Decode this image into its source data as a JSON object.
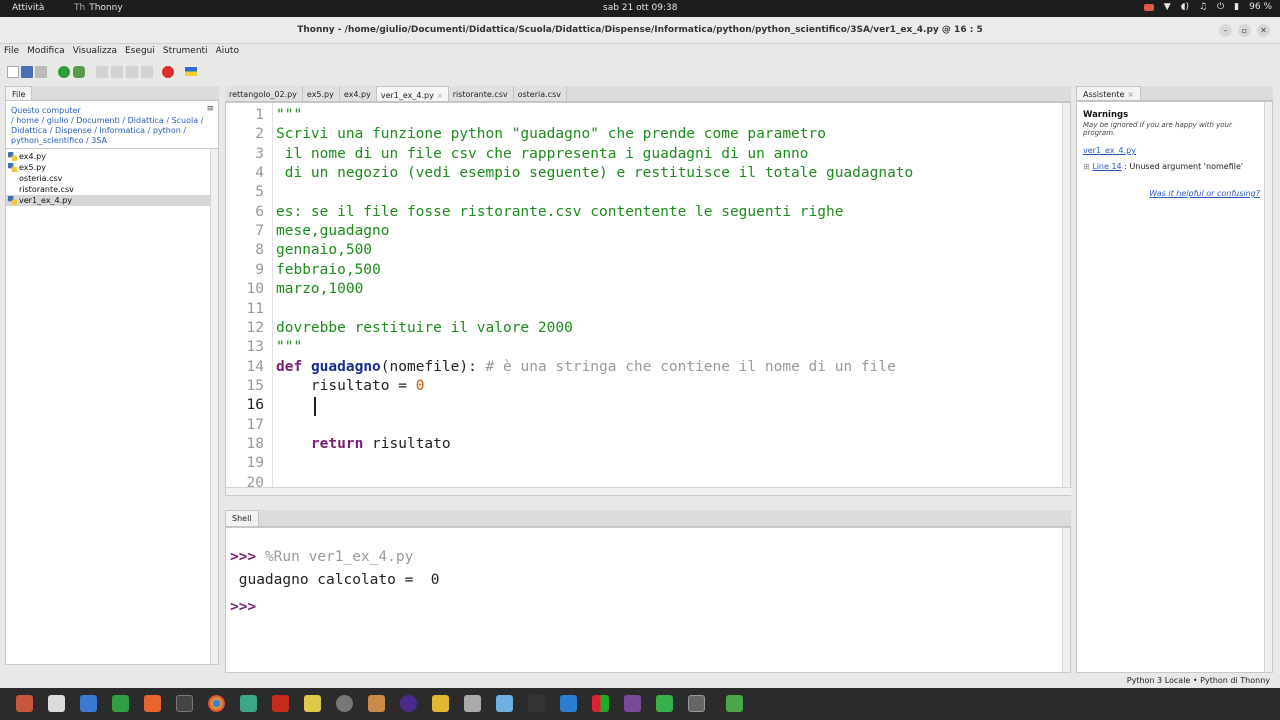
{
  "system_bar": {
    "activities": "Attività",
    "app": "Thonny",
    "clock": "sab 21 ott  09:38",
    "battery": "96 %"
  },
  "window": {
    "title": "Thonny  -  /home/giulio/Documenti/Didattica/Scuola/Didattica/Dispense/Informatica/python/python_scientifico/3SA/ver1_ex_4.py  @  16 : 5"
  },
  "menu": [
    "File",
    "Modifica",
    "Visualizza",
    "Esegui",
    "Strumenti",
    "Aiuto"
  ],
  "files_panel": {
    "tab": "File",
    "location": "Questo computer",
    "path": "/ home / giulio / Documenti / Didattica / Scuola / Didattica / Dispense / Informatica / python / python_scientifico / 3SA",
    "items": [
      {
        "name": "ex4.py",
        "type": "py"
      },
      {
        "name": "ex5.py",
        "type": "py"
      },
      {
        "name": "osteria.csv",
        "type": "csv"
      },
      {
        "name": "ristorante.csv",
        "type": "csv"
      },
      {
        "name": "ver1_ex_4.py",
        "type": "py",
        "selected": true
      }
    ]
  },
  "editor": {
    "tabs": [
      {
        "label": "rettangolo_02.py"
      },
      {
        "label": "ex5.py"
      },
      {
        "label": "ex4.py"
      },
      {
        "label": "ver1_ex_4.py",
        "active": true
      },
      {
        "label": "ristorante.csv"
      },
      {
        "label": "osteria.csv"
      }
    ],
    "current_line": 16,
    "lines": [
      "\"\"\"",
      "Scrivi una funzione python \"guadagno\" che prende come parametro",
      " il nome di un file csv che rappresenta i guadagni di un anno",
      " di un negozio (vedi esempio seguente) e restituisce il totale guadagnato",
      "",
      "es: se il file fosse ristorante.csv contentente le seguenti righe",
      "mese,guadagno",
      "gennaio,500",
      "febbraio,500",
      "marzo,1000",
      "",
      "dovrebbe restituire il valore 2000",
      "\"\"\"",
      "def guadagno(nomefile): # è una stringa che contiene il nome di un file",
      "    risultato = 0",
      "    ",
      "",
      "    return risultato",
      "",
      ""
    ]
  },
  "shell": {
    "tab": "Shell",
    "prompt": ">>>",
    "run_command": "%Run ver1_ex_4.py",
    "output": " guadagno calcolato =  0"
  },
  "assistant": {
    "tab": "Assistente",
    "heading": "Warnings",
    "subheading": "May be ignored if you are happy with your program.",
    "file_link": "ver1_ex_4.py",
    "warning_link": "Line 14",
    "warning_text": " : Unused argument 'nomefile'",
    "feedback_link": "Was it helpful or confusing?"
  },
  "status_bar": {
    "interpreter": "Python 3 Locale  •  Python di Thonny"
  },
  "colors": {
    "string": "#1e8b1e",
    "keyword": "#7a1f75",
    "function_name": "#1a2e8f",
    "comment": "#9a9a9a",
    "number": "#c2570c",
    "link": "#2a5dbd"
  }
}
